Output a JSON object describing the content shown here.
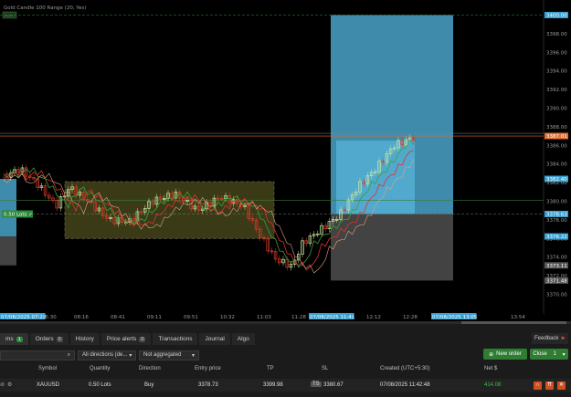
{
  "chart": {
    "title": "Gold Candle 100 Range (20, Yes)",
    "top_left_tag": "--:--",
    "price_ticks": [
      "3400.00",
      "3398.00",
      "3396.00",
      "3394.00",
      "3392.00",
      "3390.00",
      "3388.00",
      "3386.00",
      "3384.00",
      "3382.00",
      "3380.00",
      "3378.00",
      "3376.00",
      "3374.00",
      "3372.00",
      "3370.00"
    ],
    "price_tags": [
      {
        "label": "3400.00",
        "price": 3400.0,
        "color": "#3aa0d0"
      },
      {
        "label": "3387.01",
        "price": 3387.01,
        "color": "#e07030"
      },
      {
        "label": "3382.40",
        "price": 3382.4,
        "color": "#3aa0d0"
      },
      {
        "label": "3378.63",
        "price": 3378.63,
        "color": "#3aa0d0"
      },
      {
        "label": "3376.22",
        "price": 3376.22,
        "color": "#3aa0d0"
      },
      {
        "label": "3373.11",
        "price": 3373.11,
        "color": "#555555"
      },
      {
        "label": "3371.48",
        "price": 3371.48,
        "color": "#555555"
      }
    ],
    "time_labels": [
      "07/08/2025 07:29",
      "C+5:30",
      "08:16",
      "08:41",
      "09:11",
      "09:51",
      "10:32",
      "11:03",
      "11:28",
      "07/08/2025 11:41",
      "12:12",
      "12:28",
      "07/08/2025 13:05",
      "13:54"
    ],
    "position_tag": "0.50 Lots",
    "position_tag_check": "✓",
    "left_tag": "0.50 Lots",
    "colors": {
      "bull": "#c8e6a0",
      "bear": "#e03a2a",
      "tp_zone": "#4aa3c9",
      "sl_zone": "#4a4a4a",
      "entry_line": "#3a6a3a",
      "orange_line": "#e07030"
    }
  },
  "bottom": {
    "tabs": [
      {
        "label": "ms",
        "badge": "1",
        "active": true,
        "badge_green": true
      },
      {
        "label": "Orders",
        "badge": "0"
      },
      {
        "label": "History",
        "badge": ""
      },
      {
        "label": "Price alerts",
        "badge": "0"
      },
      {
        "label": "Transactions",
        "badge": ""
      },
      {
        "label": "Journal",
        "badge": ""
      },
      {
        "label": "Algo",
        "badge": ""
      }
    ],
    "feedback_label": "Feedback",
    "filters": {
      "directions": "All directions (de...",
      "aggregation": "Not aggregated"
    },
    "new_order_label": "New order",
    "close_label": "Close",
    "close_count": "1",
    "columns": [
      "Symbol",
      "Quantity",
      "Direction",
      "Entry price",
      "TP",
      "SL",
      "Created (UTC+5:30)",
      "Net $"
    ],
    "row": {
      "symbol": "XAUUSD",
      "quantity": "0.50 Lots",
      "direction": "Buy",
      "entry_price": "3378.73",
      "tp": "3399.98",
      "sl_badge": "TS",
      "sl": "3380.67",
      "created": "07/08/2025 11:42:48",
      "net": "414.08"
    }
  }
}
